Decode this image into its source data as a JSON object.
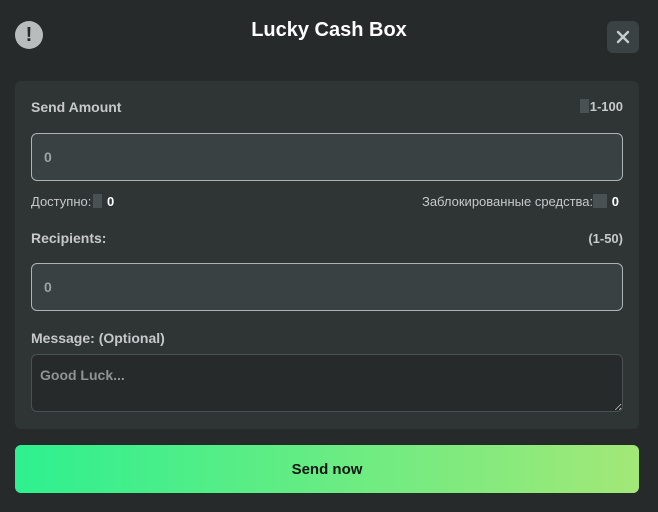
{
  "header": {
    "title": "Lucky Cash Box",
    "info_icon": "!",
    "close_icon": "close-icon"
  },
  "send_amount": {
    "label": "Send Amount",
    "range": "1-100",
    "value": "",
    "placeholder": "0"
  },
  "balance": {
    "available_label": "Доступно:",
    "available_value": "0",
    "blocked_label": "Заблокированные средства:",
    "blocked_value": "0"
  },
  "recipients": {
    "label": "Recipients:",
    "range": "(1-50)",
    "value": "",
    "placeholder": "0"
  },
  "message": {
    "label": "Message: (Optional)",
    "placeholder": "Good Luck..."
  },
  "send_button": {
    "label": "Send now"
  },
  "colors": {
    "background": "#262a2b",
    "panel": "#2f3435",
    "button_gradient_start": "#2ef08f",
    "button_gradient_end": "#a2e877"
  }
}
